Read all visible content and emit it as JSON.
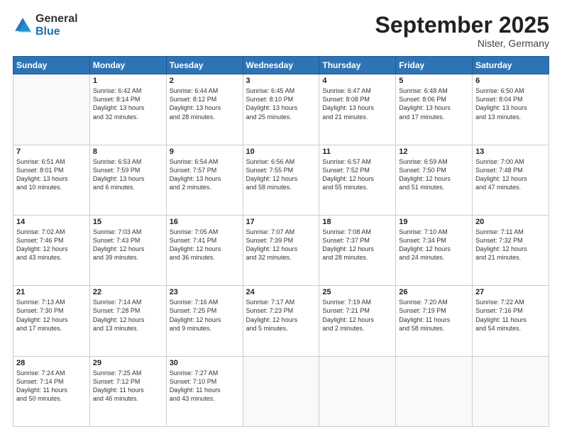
{
  "logo": {
    "general": "General",
    "blue": "Blue"
  },
  "header": {
    "month": "September 2025",
    "location": "Nister, Germany"
  },
  "weekdays": [
    "Sunday",
    "Monday",
    "Tuesday",
    "Wednesday",
    "Thursday",
    "Friday",
    "Saturday"
  ],
  "weeks": [
    [
      {
        "day": "",
        "info": ""
      },
      {
        "day": "1",
        "info": "Sunrise: 6:42 AM\nSunset: 8:14 PM\nDaylight: 13 hours\nand 32 minutes."
      },
      {
        "day": "2",
        "info": "Sunrise: 6:44 AM\nSunset: 8:12 PM\nDaylight: 13 hours\nand 28 minutes."
      },
      {
        "day": "3",
        "info": "Sunrise: 6:45 AM\nSunset: 8:10 PM\nDaylight: 13 hours\nand 25 minutes."
      },
      {
        "day": "4",
        "info": "Sunrise: 6:47 AM\nSunset: 8:08 PM\nDaylight: 13 hours\nand 21 minutes."
      },
      {
        "day": "5",
        "info": "Sunrise: 6:48 AM\nSunset: 8:06 PM\nDaylight: 13 hours\nand 17 minutes."
      },
      {
        "day": "6",
        "info": "Sunrise: 6:50 AM\nSunset: 8:04 PM\nDaylight: 13 hours\nand 13 minutes."
      }
    ],
    [
      {
        "day": "7",
        "info": "Sunrise: 6:51 AM\nSunset: 8:01 PM\nDaylight: 13 hours\nand 10 minutes."
      },
      {
        "day": "8",
        "info": "Sunrise: 6:53 AM\nSunset: 7:59 PM\nDaylight: 13 hours\nand 6 minutes."
      },
      {
        "day": "9",
        "info": "Sunrise: 6:54 AM\nSunset: 7:57 PM\nDaylight: 13 hours\nand 2 minutes."
      },
      {
        "day": "10",
        "info": "Sunrise: 6:56 AM\nSunset: 7:55 PM\nDaylight: 12 hours\nand 58 minutes."
      },
      {
        "day": "11",
        "info": "Sunrise: 6:57 AM\nSunset: 7:52 PM\nDaylight: 12 hours\nand 55 minutes."
      },
      {
        "day": "12",
        "info": "Sunrise: 6:59 AM\nSunset: 7:50 PM\nDaylight: 12 hours\nand 51 minutes."
      },
      {
        "day": "13",
        "info": "Sunrise: 7:00 AM\nSunset: 7:48 PM\nDaylight: 12 hours\nand 47 minutes."
      }
    ],
    [
      {
        "day": "14",
        "info": "Sunrise: 7:02 AM\nSunset: 7:46 PM\nDaylight: 12 hours\nand 43 minutes."
      },
      {
        "day": "15",
        "info": "Sunrise: 7:03 AM\nSunset: 7:43 PM\nDaylight: 12 hours\nand 39 minutes."
      },
      {
        "day": "16",
        "info": "Sunrise: 7:05 AM\nSunset: 7:41 PM\nDaylight: 12 hours\nand 36 minutes."
      },
      {
        "day": "17",
        "info": "Sunrise: 7:07 AM\nSunset: 7:39 PM\nDaylight: 12 hours\nand 32 minutes."
      },
      {
        "day": "18",
        "info": "Sunrise: 7:08 AM\nSunset: 7:37 PM\nDaylight: 12 hours\nand 28 minutes."
      },
      {
        "day": "19",
        "info": "Sunrise: 7:10 AM\nSunset: 7:34 PM\nDaylight: 12 hours\nand 24 minutes."
      },
      {
        "day": "20",
        "info": "Sunrise: 7:11 AM\nSunset: 7:32 PM\nDaylight: 12 hours\nand 21 minutes."
      }
    ],
    [
      {
        "day": "21",
        "info": "Sunrise: 7:13 AM\nSunset: 7:30 PM\nDaylight: 12 hours\nand 17 minutes."
      },
      {
        "day": "22",
        "info": "Sunrise: 7:14 AM\nSunset: 7:28 PM\nDaylight: 12 hours\nand 13 minutes."
      },
      {
        "day": "23",
        "info": "Sunrise: 7:16 AM\nSunset: 7:25 PM\nDaylight: 12 hours\nand 9 minutes."
      },
      {
        "day": "24",
        "info": "Sunrise: 7:17 AM\nSunset: 7:23 PM\nDaylight: 12 hours\nand 5 minutes."
      },
      {
        "day": "25",
        "info": "Sunrise: 7:19 AM\nSunset: 7:21 PM\nDaylight: 12 hours\nand 2 minutes."
      },
      {
        "day": "26",
        "info": "Sunrise: 7:20 AM\nSunset: 7:19 PM\nDaylight: 11 hours\nand 58 minutes."
      },
      {
        "day": "27",
        "info": "Sunrise: 7:22 AM\nSunset: 7:16 PM\nDaylight: 11 hours\nand 54 minutes."
      }
    ],
    [
      {
        "day": "28",
        "info": "Sunrise: 7:24 AM\nSunset: 7:14 PM\nDaylight: 11 hours\nand 50 minutes."
      },
      {
        "day": "29",
        "info": "Sunrise: 7:25 AM\nSunset: 7:12 PM\nDaylight: 11 hours\nand 46 minutes."
      },
      {
        "day": "30",
        "info": "Sunrise: 7:27 AM\nSunset: 7:10 PM\nDaylight: 11 hours\nand 43 minutes."
      },
      {
        "day": "",
        "info": ""
      },
      {
        "day": "",
        "info": ""
      },
      {
        "day": "",
        "info": ""
      },
      {
        "day": "",
        "info": ""
      }
    ]
  ]
}
